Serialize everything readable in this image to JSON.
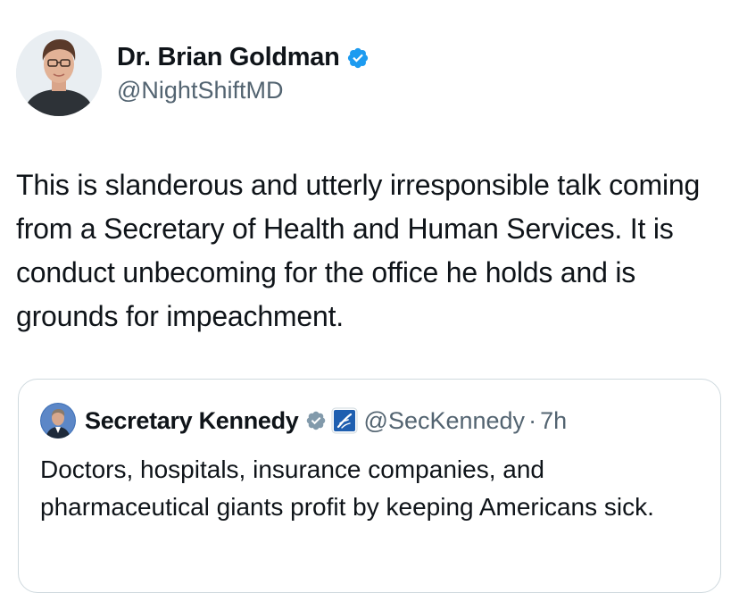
{
  "tweet": {
    "author": {
      "display_name": "Dr. Brian Goldman",
      "handle": "@NightShiftMD",
      "verified_icon": "verified-badge-blue"
    },
    "text": "This is slanderous and utterly irresponsible talk coming from a Secretary of Health and Human Services. It is conduct unbecoming for the office he holds and is grounds for impeachment.",
    "quoted_tweet": {
      "display_name": "Secretary Kennedy",
      "verified_icon": "verified-badge-gray",
      "affiliation_icon": "hhs-agency-badge",
      "handle": "@SecKennedy",
      "separator": "·",
      "time": "7h",
      "text": "Doctors, hospitals, insurance companies, and pharmaceutical giants profit by keeping Americans sick."
    }
  },
  "colors": {
    "text_primary": "#0f1419",
    "text_secondary": "#536471",
    "verified_blue": "#1d9bf0",
    "verified_gray": "#829aab",
    "border": "#cfd9de",
    "hhs_blue": "#1f5fb0"
  }
}
